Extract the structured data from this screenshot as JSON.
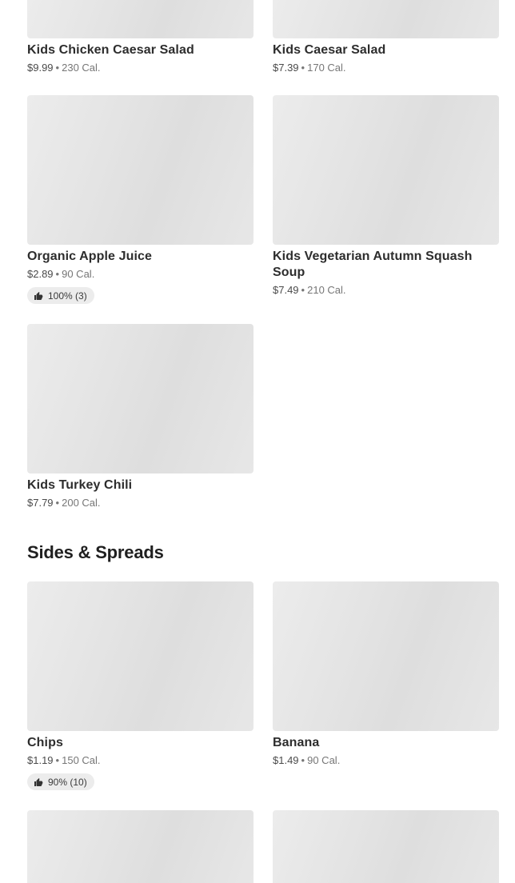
{
  "items_top": [
    {
      "name": "Kids Chicken Caesar Salad",
      "price": "$9.99",
      "cal": "230 Cal."
    },
    {
      "name": "Kids Caesar Salad",
      "price": "$7.39",
      "cal": "170 Cal."
    },
    {
      "name": "Organic Apple Juice",
      "price": "$2.89",
      "cal": "90 Cal.",
      "rating": "100% (3)"
    },
    {
      "name": "Kids Vegetarian Autumn Squash Soup",
      "price": "$7.49",
      "cal": "210 Cal."
    },
    {
      "name": "Kids Turkey Chili",
      "price": "$7.79",
      "cal": "200 Cal."
    }
  ],
  "section": {
    "title": "Sides & Spreads"
  },
  "items_sides": [
    {
      "name": "Chips",
      "price": "$1.19",
      "cal": "150 Cal.",
      "rating": "90% (10)"
    },
    {
      "name": "Banana",
      "price": "$1.49",
      "cal": "90 Cal."
    }
  ],
  "separator": "•",
  "icons": {
    "rating": "thumbs-up-icon"
  }
}
